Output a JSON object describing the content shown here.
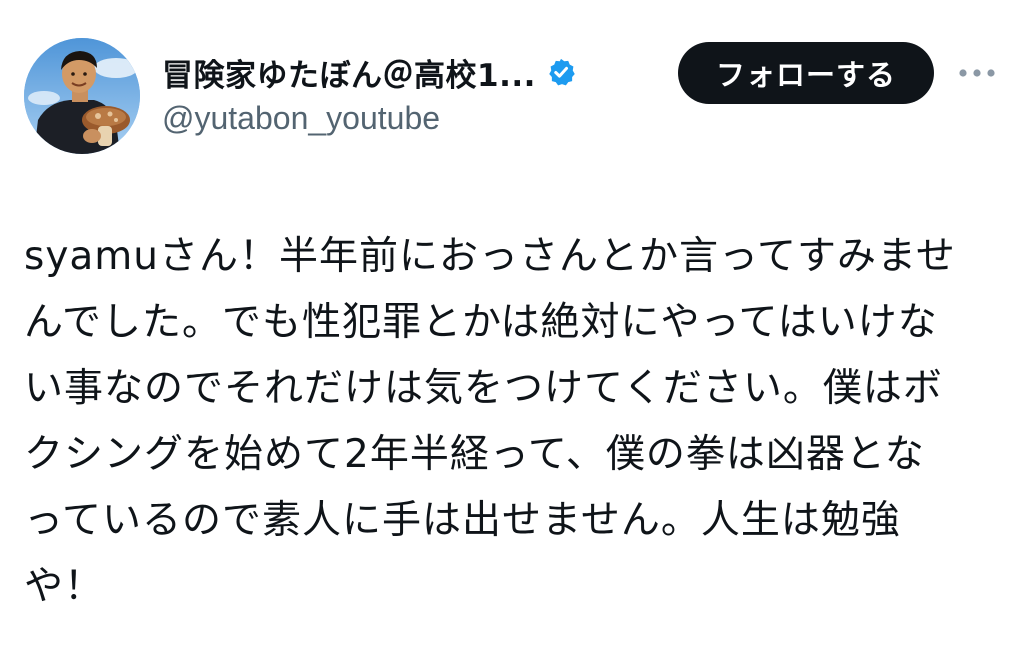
{
  "tweet": {
    "author": {
      "display_name": "冒険家ゆたぼん＠高校1...",
      "handle": "@yutabon_youtube",
      "verified": true,
      "verified_color": "#1d9bf0",
      "avatar_icon": "profile-photo"
    },
    "actions": {
      "follow_label": "フォローする",
      "more_icon": "more-horizontal-icon"
    },
    "body_lines": [
      "syamuさん！半年前におっさんとか言ってすみませ",
      "んでした。でも性犯罪とかは絶対にやってはいけな",
      "い事なのでそれだけは気をつけてください。僕はボ",
      "クシングを始めて2年半経って、僕の拳は凶器とな",
      "っているので素人に手は出せません。人生は勉強",
      "や！"
    ]
  },
  "colors": {
    "text_primary": "#0f1419",
    "text_secondary": "#536471",
    "button_bg": "#0f1419",
    "button_text": "#ffffff",
    "background": "#ffffff"
  }
}
